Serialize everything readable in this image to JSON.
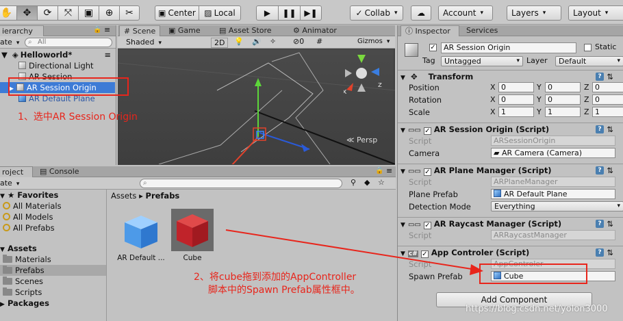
{
  "toolbar": {
    "pivot": "Center",
    "space": "Local",
    "collab": "Collab",
    "account": "Account",
    "layers": "Layers",
    "layout": "Layout"
  },
  "hierarchy": {
    "tab": "ierarchy",
    "create": "ate",
    "search_placeholder": "All",
    "scene_name": "Helloworld*",
    "items": [
      {
        "label": "Directional Light"
      },
      {
        "label": "AR Session"
      },
      {
        "label": "AR Session Origin"
      },
      {
        "label": "AR Default Plane"
      }
    ]
  },
  "scene": {
    "tabs": [
      "Scene",
      "Game",
      "Asset Store",
      "Animator"
    ],
    "shading": "Shaded",
    "mode_2d": "2D",
    "gizmo_count": "0",
    "gizmos": "Gizmos",
    "search_placeholder": "All",
    "persp": "Persp"
  },
  "project": {
    "tabs": [
      "roject",
      "Console"
    ],
    "create": "ate",
    "favorites_title": "Favorites",
    "favorites": [
      "All Materials",
      "All Models",
      "All Prefabs"
    ],
    "assets_title": "Assets",
    "folders": [
      "Materials",
      "Prefabs",
      "Scenes",
      "Scripts"
    ],
    "packages_title": "Packages",
    "breadcrumb": [
      "Assets",
      "Prefabs"
    ],
    "files": [
      {
        "label": "AR Default ...",
        "color": "#5aa8ee"
      },
      {
        "label": "Cube",
        "color": "#c81f25"
      }
    ]
  },
  "inspector": {
    "tabs": [
      "Inspector",
      "Services"
    ],
    "object_name": "AR Session Origin",
    "static_label": "Static",
    "tag_label": "Tag",
    "tag_value": "Untagged",
    "layer_label": "Layer",
    "layer_value": "Default",
    "transform": {
      "title": "Transform",
      "rows": [
        {
          "label": "Position",
          "x": "0",
          "y": "0",
          "z": "0"
        },
        {
          "label": "Rotation",
          "x": "0",
          "y": "0",
          "z": "0"
        },
        {
          "label": "Scale",
          "x": "1",
          "y": "1",
          "z": "1"
        }
      ],
      "axis": [
        "X",
        "Y",
        "Z"
      ]
    },
    "session_origin": {
      "title": "AR Session Origin (Script)",
      "script_label": "Script",
      "script_value": "ARSessionOrigin",
      "camera_label": "Camera",
      "camera_value": "AR Camera (Camera)"
    },
    "plane_manager": {
      "title": "AR Plane Manager (Script)",
      "script_label": "Script",
      "script_value": "ARPlaneManager",
      "prefab_label": "Plane Prefab",
      "prefab_value": "AR Default Plane",
      "detection_label": "Detection Mode",
      "detection_value": "Everything"
    },
    "raycast_manager": {
      "title": "AR Raycast Manager (Script)",
      "script_label": "Script",
      "script_value": "ARRaycastManager"
    },
    "app_controler": {
      "title": "App Controler (Script)",
      "script_label": "Script",
      "script_value": "AppControler",
      "spawn_label": "Spawn Prefab",
      "spawn_value": "Cube"
    },
    "add_component": "Add Component"
  },
  "annotations": {
    "step1": "1、选中AR Session Origin",
    "step2_line1": "2、将cube拖到添加的AppController",
    "step2_line2": "脚本中的Spawn Prefab属性框中。",
    "watermark": "https://blog.csdn.net/yolon3000",
    "color": "#e8251b"
  }
}
